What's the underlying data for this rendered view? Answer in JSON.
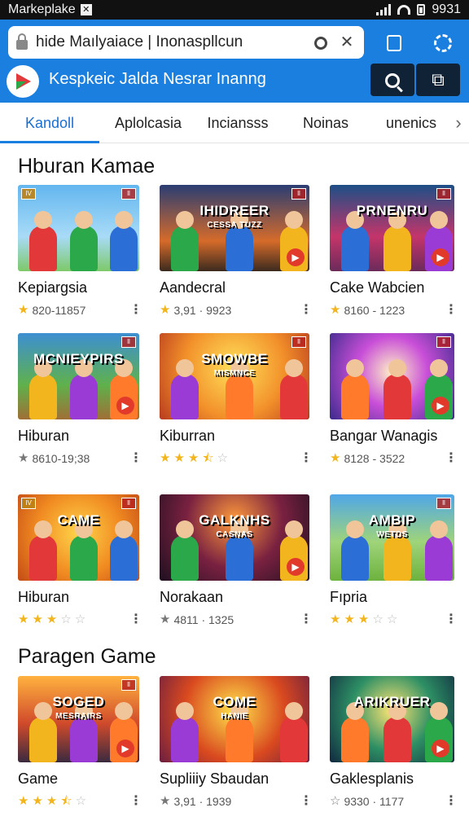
{
  "status_bar": {
    "app_name": "Markeplake",
    "time": "9931"
  },
  "browser": {
    "url": "hide Maılyaiace | Inonaspllcun"
  },
  "store": {
    "title": "Kespkeic Jalda Nesrar Inanng"
  },
  "tabs": [
    {
      "label": "Kandoll",
      "active": true
    },
    {
      "label": "Aplolcasia",
      "active": false
    },
    {
      "label": "Inciansss",
      "active": false
    },
    {
      "label": "Noinas",
      "active": false
    },
    {
      "label": "unenics",
      "active": false
    }
  ],
  "sections": [
    {
      "title": "Hburan Kamae"
    },
    {
      "title": "Paragen Game"
    }
  ],
  "cards": [
    {
      "title": "Kepiargsia",
      "meta": "820-11857",
      "rating_stars": 1,
      "star_style": "gold",
      "art": "",
      "art_sub": "",
      "badge_l": "IV",
      "badge_r": "ll"
    },
    {
      "title": "Aandecral",
      "meta": "3,91 · 9923",
      "rating_stars": 1,
      "star_style": "gold",
      "art": "IHIDREER",
      "art_sub": "CESSA TUZZ",
      "badge_l": "",
      "badge_r": "ll"
    },
    {
      "title": "Cake Wabcien",
      "meta": "8160 - 1223",
      "rating_stars": 1,
      "star_style": "gold",
      "art": "PRNENRU",
      "art_sub": "",
      "badge_l": "",
      "badge_r": "ll"
    },
    {
      "title": "Hiburan",
      "meta": "8610-19;38",
      "rating_stars": 1,
      "star_style": "grey",
      "art": "MCNIEYPIRS",
      "art_sub": "",
      "badge_l": "",
      "badge_r": "ll"
    },
    {
      "title": "Kiburran",
      "meta": "",
      "rating_stars": 3.5,
      "star_style": "gold",
      "art": "SMOWBE",
      "art_sub": "MISMNCE",
      "badge_l": "",
      "badge_r": "ll"
    },
    {
      "title": "Bangar Wanagis",
      "meta": "8128 - 3522",
      "rating_stars": 1,
      "star_style": "gold",
      "art": "",
      "art_sub": "",
      "badge_l": "",
      "badge_r": "ll"
    },
    {
      "title": "Hiburan",
      "meta": "",
      "rating_stars": 3,
      "star_style": "gold",
      "art": "CAME",
      "art_sub": "",
      "badge_l": "IV",
      "badge_r": "ll"
    },
    {
      "title": "Norakaan",
      "meta": "4811 · 1325",
      "rating_stars": 1,
      "star_style": "grey",
      "art": "GALKNHS",
      "art_sub": "CASNAS",
      "badge_l": "",
      "badge_r": ""
    },
    {
      "title": "Fıpria",
      "meta": "",
      "rating_stars": 3,
      "star_style": "gold",
      "art": "AMBIP",
      "art_sub": "WETDS",
      "badge_l": "",
      "badge_r": "ll"
    },
    {
      "title": "Game",
      "meta": "",
      "rating_stars": 3.5,
      "star_style": "gold",
      "art": "SOGED",
      "art_sub": "MESRAIRS",
      "badge_l": "",
      "badge_r": "ll"
    },
    {
      "title": "Supliiiy Sbaudan",
      "meta": "3,91 · 1939",
      "rating_stars": 1,
      "star_style": "grey",
      "art": "COME",
      "art_sub": "HANIE",
      "badge_l": "",
      "badge_r": ""
    },
    {
      "title": "Gaklesplanis",
      "meta": "9330 · 1177",
      "rating_stars": 1,
      "star_style": "outline",
      "art": "ARIKRUER",
      "art_sub": "",
      "badge_l": "",
      "badge_r": ""
    }
  ],
  "colors": {
    "accent": "#1b7fe0",
    "star": "#f2b51d",
    "active_tab": "#1b6fd0"
  }
}
